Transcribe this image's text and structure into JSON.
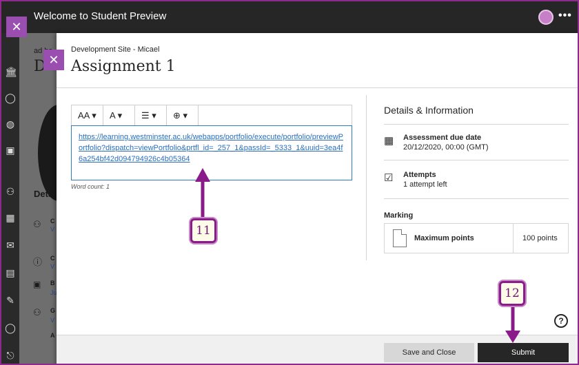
{
  "topbar": {
    "title": "Welcome to Student Preview",
    "more_label": "•••"
  },
  "panel": {
    "breadcrumb": "Development Site - Micael",
    "title": "Assignment 1"
  },
  "background_page": {
    "partial_course_text": "ad ha",
    "partial_title": "D",
    "partial_details": "Deta",
    "partial_letters": [
      "C",
      "V",
      "C",
      "V",
      "B",
      "Ju",
      "G",
      "V",
      "A"
    ]
  },
  "editor": {
    "toolbar": [
      {
        "name": "paragraph-style",
        "glyph": "AA ▾"
      },
      {
        "name": "text-format",
        "glyph": "A ▾"
      },
      {
        "name": "list",
        "glyph": "☰ ▾"
      },
      {
        "name": "insert",
        "glyph": "⊕ ▾"
      }
    ],
    "content": "https://learning.westminster.ac.uk/webapps/portfolio/execute/portfolio/previewPortfolio?dispatch=viewPortfolio&prtfl_id=_257_1&passId=_5333_1&uuid=3ea4f6a254bf42d094794926c4b05364",
    "word_count": "Word count: 1"
  },
  "details": {
    "heading": "Details & Information",
    "due_label": "Assessment due date",
    "due_value": "20/12/2020, 00:00 (GMT)",
    "attempts_label": "Attempts",
    "attempts_value": "1 attempt left",
    "marking_label": "Marking",
    "max_points_label": "Maximum points",
    "max_points_value": "100 points"
  },
  "footer": {
    "save_close": "Save and Close",
    "submit": "Submit"
  },
  "annotations": {
    "marker_11": "11",
    "marker_12": "12"
  },
  "colors": {
    "accent": "#8a1c8a",
    "topbar": "#262626",
    "link": "#2a6ebb"
  }
}
